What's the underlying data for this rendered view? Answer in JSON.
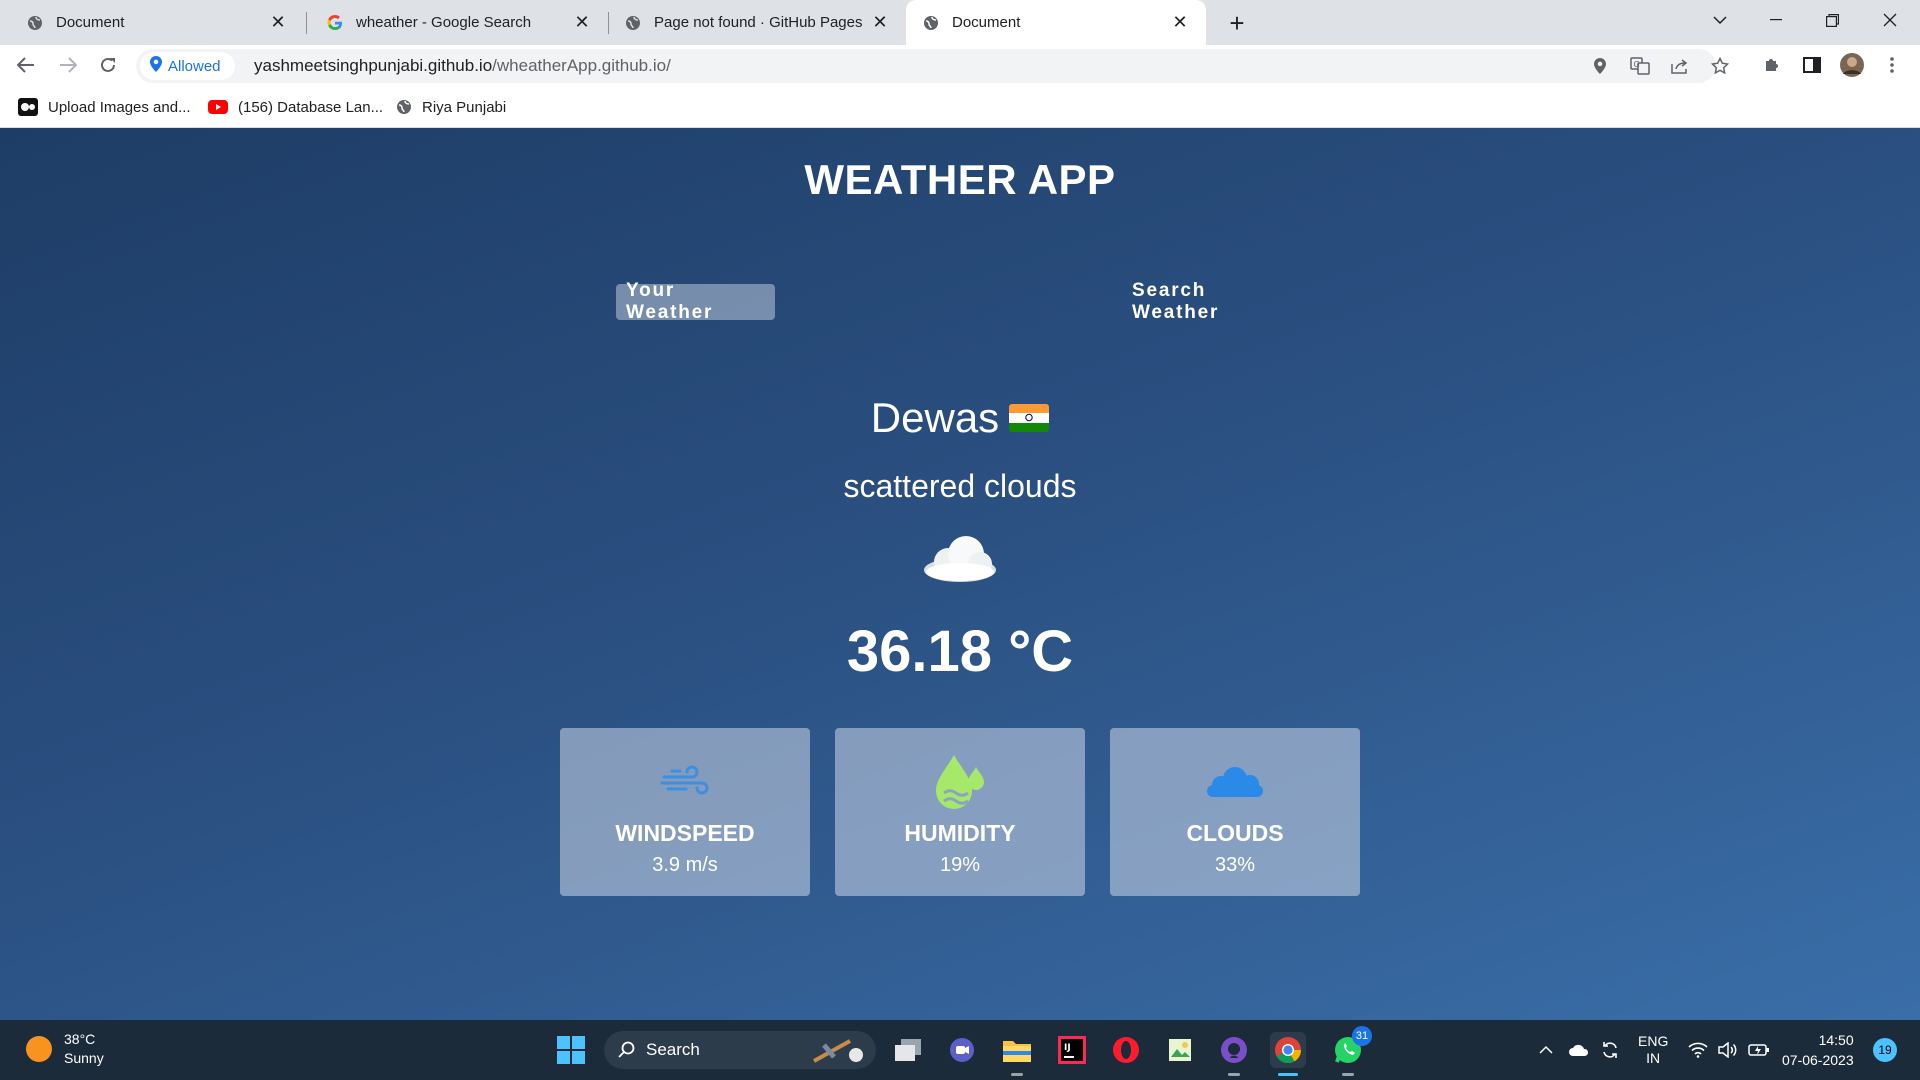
{
  "browser": {
    "tabs": [
      {
        "title": "Document",
        "close": "✕",
        "active": false
      },
      {
        "title": "wheather - Google Search",
        "close": "✕",
        "active": false
      },
      {
        "title": "Page not found · GitHub Pages",
        "close": "✕",
        "active": false
      },
      {
        "title": "Document",
        "close": "✕",
        "active": true
      }
    ],
    "new_tab": "+",
    "site_chip": "Allowed",
    "url_host": "yashmeetsinghpunjabi.github.io",
    "url_path": "/wheatherApp.github.io/",
    "bookmarks": [
      {
        "label": "Upload Images and..."
      },
      {
        "label": "(156) Database Lan..."
      },
      {
        "label": "Riya Punjabi"
      }
    ]
  },
  "app": {
    "title": "WEATHER APP",
    "tabs": {
      "your_weather": "Your Weather",
      "search_weather": "Search Weather",
      "active": "your_weather"
    },
    "city": "Dewas",
    "description": "scattered clouds",
    "temperature": "36.18 °C",
    "cards": [
      {
        "label": "WINDSPEED",
        "value": "3.9 m/s",
        "icon": "wind-icon"
      },
      {
        "label": "HUMIDITY",
        "value": "19%",
        "icon": "humidity-icon"
      },
      {
        "label": "CLOUDS",
        "value": "33%",
        "icon": "cloud-icon"
      }
    ]
  },
  "taskbar": {
    "weather_temp": "38°C",
    "weather_desc": "Sunny",
    "search_label": "Search",
    "whatsapp_badge": "31",
    "lang_line1": "ENG",
    "lang_line2": "IN",
    "time": "14:50",
    "date": "07-06-2023",
    "notifications": "19"
  },
  "colors": {
    "page_gradient_start": "#1e3d66",
    "page_gradient_end": "#3a6ea8",
    "card_bg": "#8ca3c7",
    "wind_icon": "#3d8fe0",
    "humidity_icon": "#a6e86a",
    "cloud_icon": "#2b8ae8",
    "chip_blue": "#1a73e8"
  }
}
